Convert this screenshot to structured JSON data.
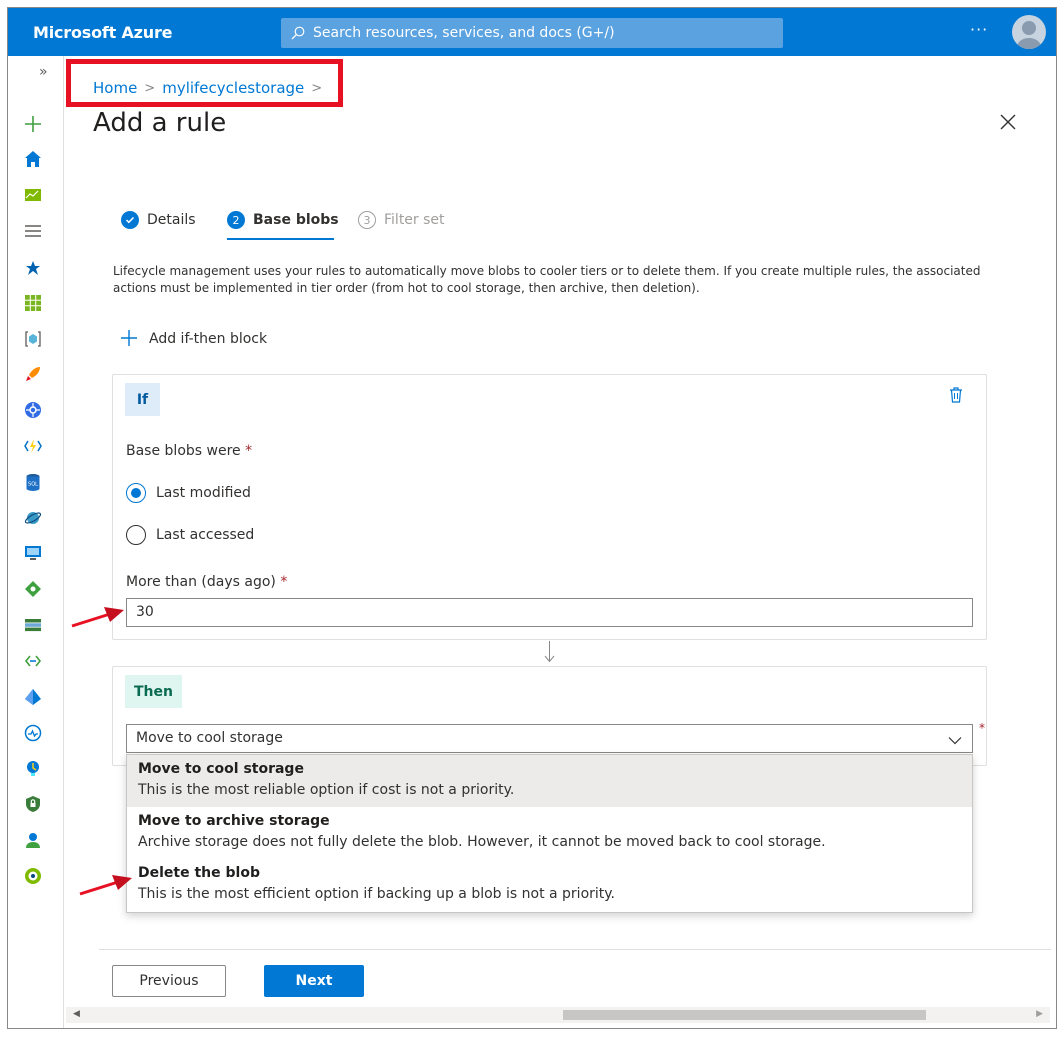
{
  "app": {
    "brand": "Microsoft Azure",
    "more_label": "···"
  },
  "search": {
    "placeholder": "Search resources, services, and docs (G+/)"
  },
  "rail": {
    "expand_label": "»"
  },
  "breadcrumb": {
    "home": "Home",
    "separator": ">",
    "resource": "mylifecyclestorage"
  },
  "page": {
    "title": "Add a rule"
  },
  "steps": [
    {
      "number": "✓",
      "label": "Details",
      "state": "completed"
    },
    {
      "number": "2",
      "label": "Base blobs",
      "state": "active"
    },
    {
      "number": "3",
      "label": "Filter set",
      "state": "disabled"
    }
  ],
  "description": "Lifecycle management uses your rules to automatically move blobs to cooler tiers or to delete them. If you create multiple rules, the associated actions must be implemented in tier order (from hot to cool storage, then archive, then deletion).",
  "add_block_label": "Add if-then block",
  "if_block": {
    "tag": "If",
    "base_blobs_label": "Base blobs were",
    "required_mark": "*",
    "options": [
      {
        "label": "Last modified",
        "selected": true
      },
      {
        "label": "Last accessed",
        "selected": false
      }
    ],
    "days_label": "More than (days ago)",
    "days_value": "30"
  },
  "then_block": {
    "tag": "Then",
    "selected": "Move to cool storage",
    "options": [
      {
        "title": "Move to cool storage",
        "subtitle": "This is the most reliable option if cost is not a priority."
      },
      {
        "title": "Move to archive storage",
        "subtitle": "Archive storage does not fully delete the blob. However, it cannot be moved back to cool storage."
      },
      {
        "title": "Delete the blob",
        "subtitle": "This is the most efficient option if backing up a blob is not a priority."
      }
    ]
  },
  "buttons": {
    "previous": "Previous",
    "next": "Next"
  },
  "colors": {
    "accent": "#0078d4",
    "annotation": "#e81123",
    "if_tag_bg": "#deecf9",
    "then_tag_bg": "#dff6f0"
  }
}
